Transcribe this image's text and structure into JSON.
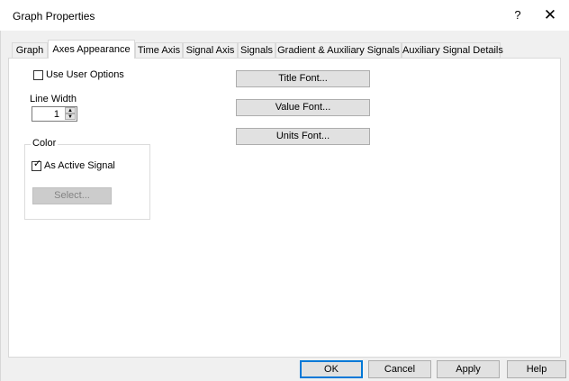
{
  "window": {
    "title": "Graph Properties",
    "help_glyph": "?",
    "close_glyph": "✕"
  },
  "tabs": [
    {
      "label": "Graph",
      "active": false
    },
    {
      "label": "Axes Appearance",
      "active": true
    },
    {
      "label": "Time Axis",
      "active": false
    },
    {
      "label": "Signal Axis",
      "active": false
    },
    {
      "label": "Signals",
      "active": false
    },
    {
      "label": "Gradient & Auxiliary Signals",
      "active": false
    },
    {
      "label": "Auxiliary Signal Details",
      "active": false
    }
  ],
  "options": {
    "use_user_options_label": "Use User Options",
    "use_user_options_checked": false,
    "line_width_label": "Line Width",
    "line_width_value": "1"
  },
  "color_group": {
    "legend": "Color",
    "as_active_signal_label": "As Active Signal",
    "as_active_signal_checked": true,
    "check_glyph": "✓",
    "select_label": "Select..."
  },
  "font_buttons": {
    "title_font": "Title Font...",
    "value_font": "Value Font...",
    "units_font": "Units Font..."
  },
  "footer": {
    "ok": "OK",
    "cancel": "Cancel",
    "apply": "Apply",
    "help": "Help"
  },
  "colors": {
    "dialog_bg": "#f0f0f0",
    "panel_bg": "#ffffff",
    "default_button_border": "#0078d7"
  }
}
